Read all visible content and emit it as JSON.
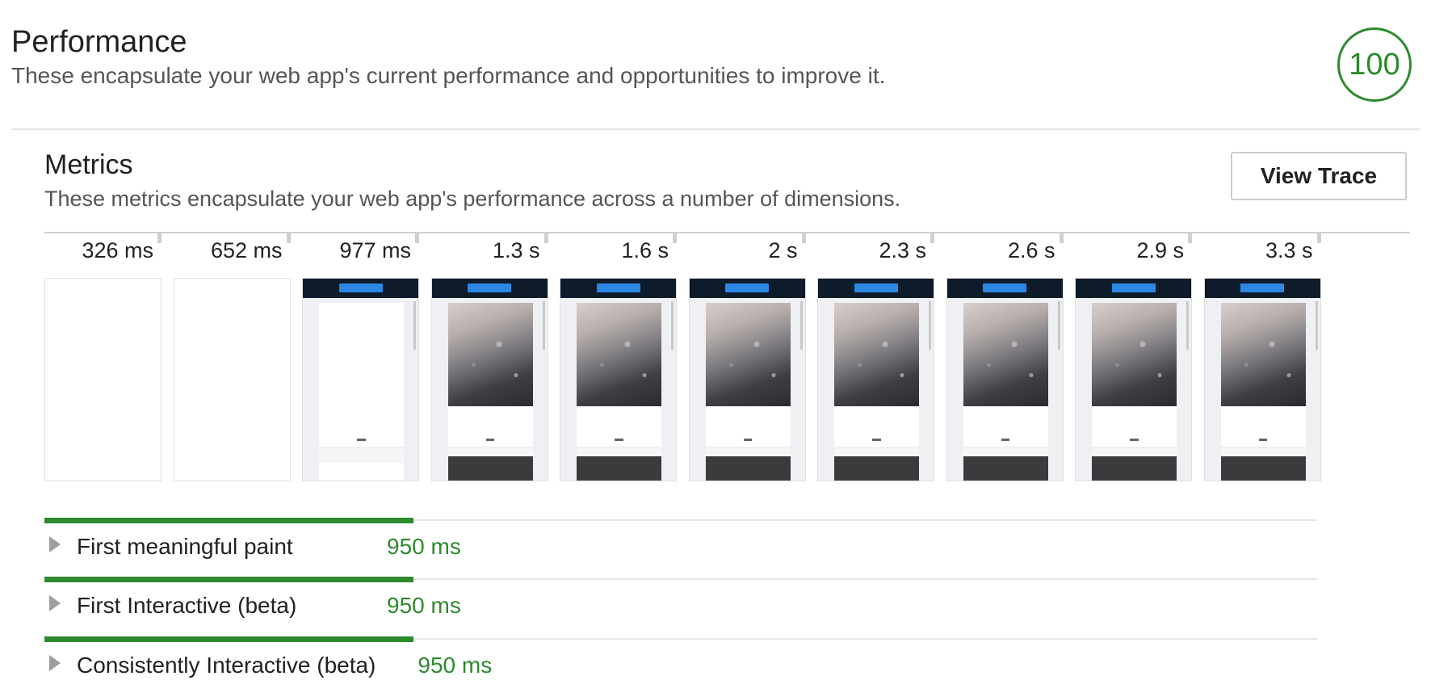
{
  "category": {
    "title": "Performance",
    "description": "These encapsulate your web app's current performance and opportunities to improve it.",
    "score": "100",
    "score_color": "#2d8a2d"
  },
  "metrics_section": {
    "title": "Metrics",
    "description": "These metrics encapsulate your web app's performance across a number of dimensions.",
    "view_trace_label": "View Trace"
  },
  "filmstrip": {
    "timestamps": [
      "326 ms",
      "652 ms",
      "977 ms",
      "1.3 s",
      "1.6 s",
      "2 s",
      "2.3 s",
      "2.6 s",
      "2.9 s",
      "3.3 s"
    ],
    "frames": [
      {
        "state": "blank"
      },
      {
        "state": "blank"
      },
      {
        "state": "partial"
      },
      {
        "state": "loaded"
      },
      {
        "state": "loaded"
      },
      {
        "state": "loaded"
      },
      {
        "state": "loaded"
      },
      {
        "state": "loaded"
      },
      {
        "state": "loaded"
      },
      {
        "state": "loaded"
      }
    ]
  },
  "metrics": [
    {
      "label": "First meaningful paint",
      "value": "950 ms",
      "progress_fraction": 0.29
    },
    {
      "label": "First Interactive (beta)",
      "value": "950 ms",
      "progress_fraction": 0.29
    },
    {
      "label": "Consistently Interactive (beta)",
      "value": "950 ms",
      "progress_fraction": 0.29
    }
  ],
  "colors": {
    "pass": "#2d8a2d",
    "expand_arrow": "#9e9e9e"
  },
  "icons": {
    "expand": "triangle-right-icon"
  }
}
